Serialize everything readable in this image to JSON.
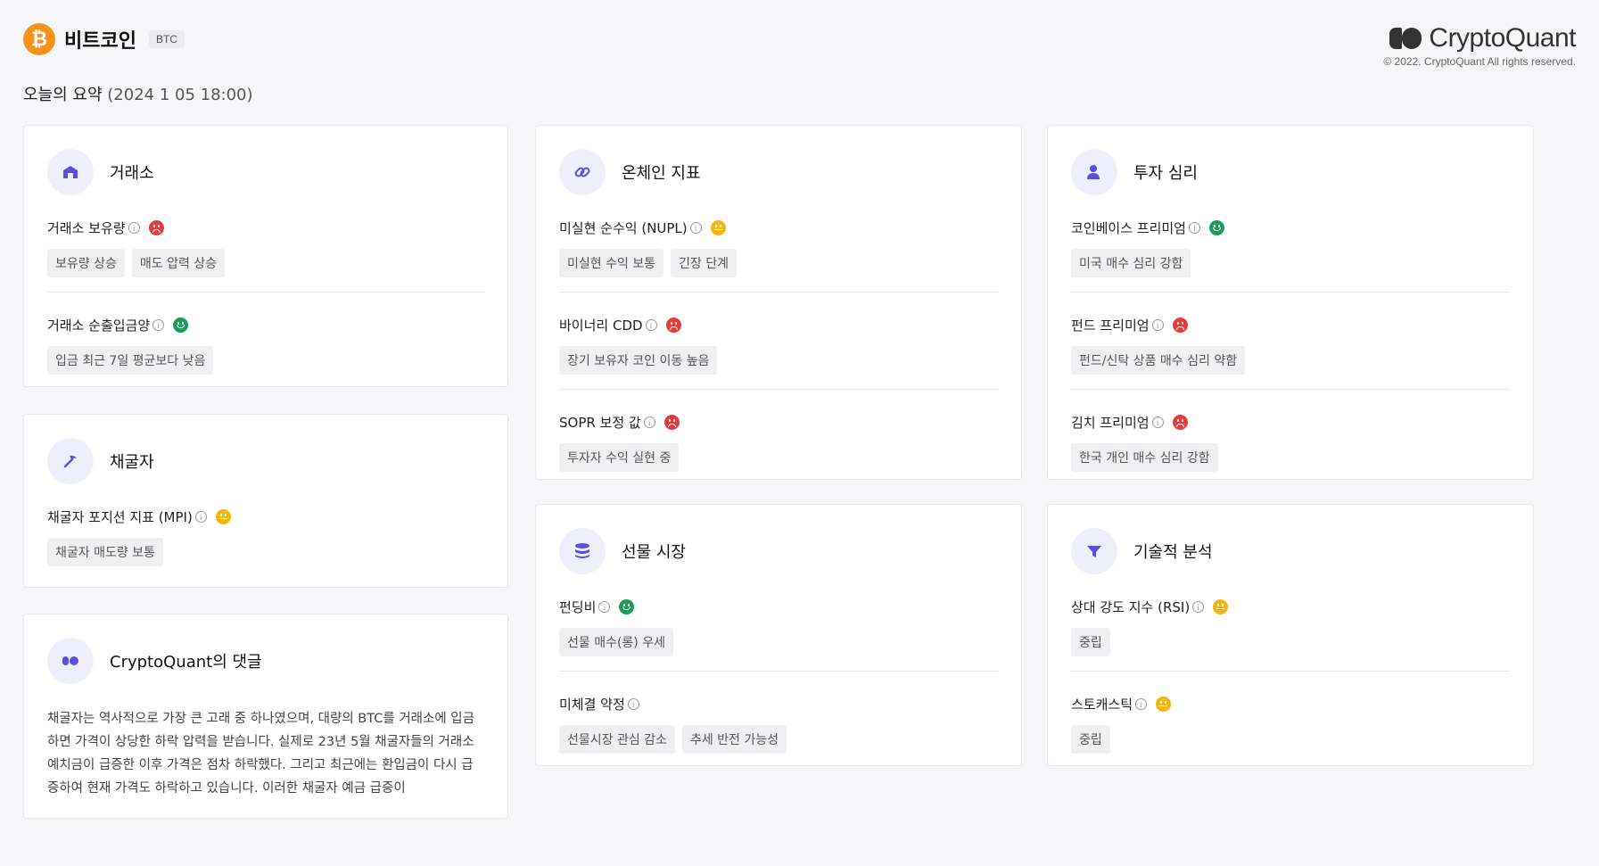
{
  "header": {
    "coin_symbol": "₿",
    "coin_name": "비트코인",
    "ticker": "BTC",
    "brand": "CryptoQuant",
    "copyright": "© 2022. CryptoQuant All rights reserved."
  },
  "summary": {
    "label": "오늘의 요약",
    "date": "(2024 1 05 18:00)"
  },
  "icons": {
    "info": "i"
  },
  "colors": {
    "negative": "#e93b3b",
    "positive": "#1e9b5a",
    "neutral": "#f5b50a",
    "btc": "#f7931a",
    "accent": "#5b4fe0"
  },
  "cards": {
    "exchange": {
      "title": "거래소",
      "icon": "building-icon",
      "metrics": [
        {
          "name": "거래소 보유량",
          "status": "negative",
          "tags": [
            "보유량 상승",
            "매도 압력 상승"
          ]
        },
        {
          "name": "거래소 순출입금양",
          "status": "positive",
          "tags": [
            "입금 최근 7일 평균보다 낮음"
          ]
        }
      ]
    },
    "miner": {
      "title": "채굴자",
      "icon": "pickaxe-icon",
      "metrics": [
        {
          "name": "채굴자 포지션 지표 (MPI)",
          "status": "neutral",
          "tags": [
            "채굴자 매도량 보통"
          ]
        }
      ]
    },
    "comment": {
      "title": "CryptoQuant의 댓글",
      "icon": "quote-icon",
      "text": "채굴자는 역사적으로 가장 큰 고래 중 하나였으며, 대량의 BTC를 거래소에 입금하면 가격이 상당한 하락 압력을 받습니다. 실제로 23년 5월 채굴자들의 거래소 예치금이 급증한 이후 가격은 점차 하락했다. 그리고 최근에는 환입금이 다시 급증하여 현재 가격도 하락하고 있습니다. 이러한 채굴자 예금 급증이"
    },
    "onchain": {
      "title": "온체인 지표",
      "icon": "link-icon",
      "metrics": [
        {
          "name": "미실현 순수익 (NUPL)",
          "status": "neutral",
          "tags": [
            "미실현 수익 보통",
            "긴장 단계"
          ]
        },
        {
          "name": "바이너리 CDD",
          "status": "negative",
          "tags": [
            "장기 보유자 코인 이동 높음"
          ]
        },
        {
          "name": "SOPR 보정 값",
          "status": "negative",
          "tags": [
            "투자자 수익 실현 중"
          ]
        }
      ]
    },
    "futures": {
      "title": "선물 시장",
      "icon": "database-icon",
      "metrics": [
        {
          "name": "펀딩비",
          "status": "positive",
          "tags": [
            "선물 매수(롱) 우세"
          ]
        },
        {
          "name": "미체결 약정",
          "status": "none",
          "tags": [
            "선물시장 관심 감소",
            "추세 반전 가능성"
          ]
        }
      ]
    },
    "sentiment": {
      "title": "투자 심리",
      "icon": "user-icon",
      "metrics": [
        {
          "name": "코인베이스 프리미엄",
          "status": "positive",
          "tags": [
            "미국 매수 심리 강함"
          ]
        },
        {
          "name": "펀드 프리미엄",
          "status": "negative",
          "tags": [
            "펀드/신탁 상품 매수 심리 약함"
          ]
        },
        {
          "name": "김치 프리미엄",
          "status": "negative",
          "tags": [
            "한국 개인 매수 심리 강함"
          ]
        }
      ]
    },
    "technical": {
      "title": "기술적 분석",
      "icon": "funnel-icon",
      "metrics": [
        {
          "name": "상대 강도 지수 (RSI)",
          "status": "neutral",
          "tags": [
            "중립"
          ]
        },
        {
          "name": "스토캐스틱",
          "status": "neutral",
          "tags": [
            "중립"
          ]
        }
      ]
    }
  }
}
